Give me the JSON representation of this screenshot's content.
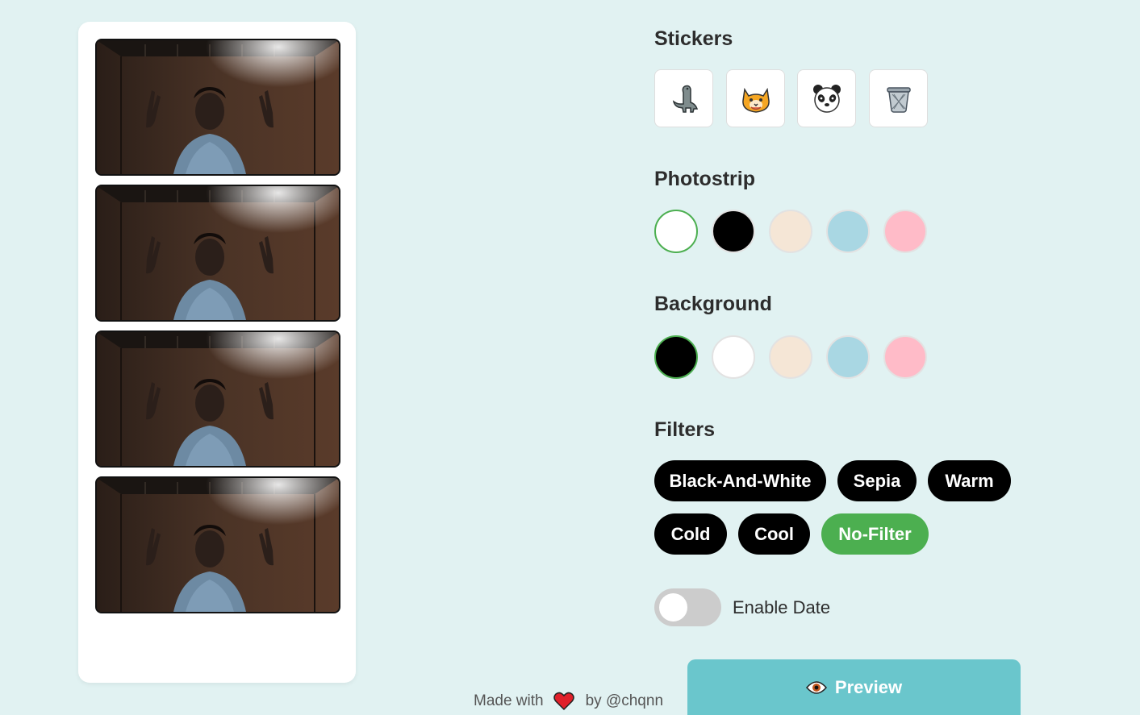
{
  "strip": {
    "photo_count": 4
  },
  "stickers": {
    "title": "Stickers",
    "items": [
      {
        "name": "dinosaur",
        "icon": "dinosaur-icon"
      },
      {
        "name": "cat",
        "icon": "cat-icon"
      },
      {
        "name": "panda",
        "icon": "panda-icon"
      },
      {
        "name": "clear",
        "icon": "trash-icon"
      }
    ]
  },
  "photostrip": {
    "title": "Photostrip",
    "colors": [
      "#ffffff",
      "#000000",
      "#f5e6d6",
      "#a9d7e3",
      "#ffbbc8"
    ],
    "selected": "#ffffff"
  },
  "background": {
    "title": "Background",
    "colors": [
      "#000000",
      "#ffffff",
      "#f5e6d6",
      "#a9d7e3",
      "#ffbbc8"
    ],
    "selected": "#000000"
  },
  "filters": {
    "title": "Filters",
    "items": [
      "Black-And-White",
      "Sepia",
      "Warm",
      "Cold",
      "Cool",
      "No-Filter"
    ],
    "active": "No-Filter"
  },
  "date_toggle": {
    "label": "Enable Date",
    "enabled": false
  },
  "preview": {
    "label": "Preview",
    "icon": "eye-icon"
  },
  "footer": {
    "made_with": "Made with",
    "by": "by @chqnn",
    "icon": "heart-icon"
  },
  "accent_color": "#4caf50",
  "preview_color": "#6ac6cc"
}
